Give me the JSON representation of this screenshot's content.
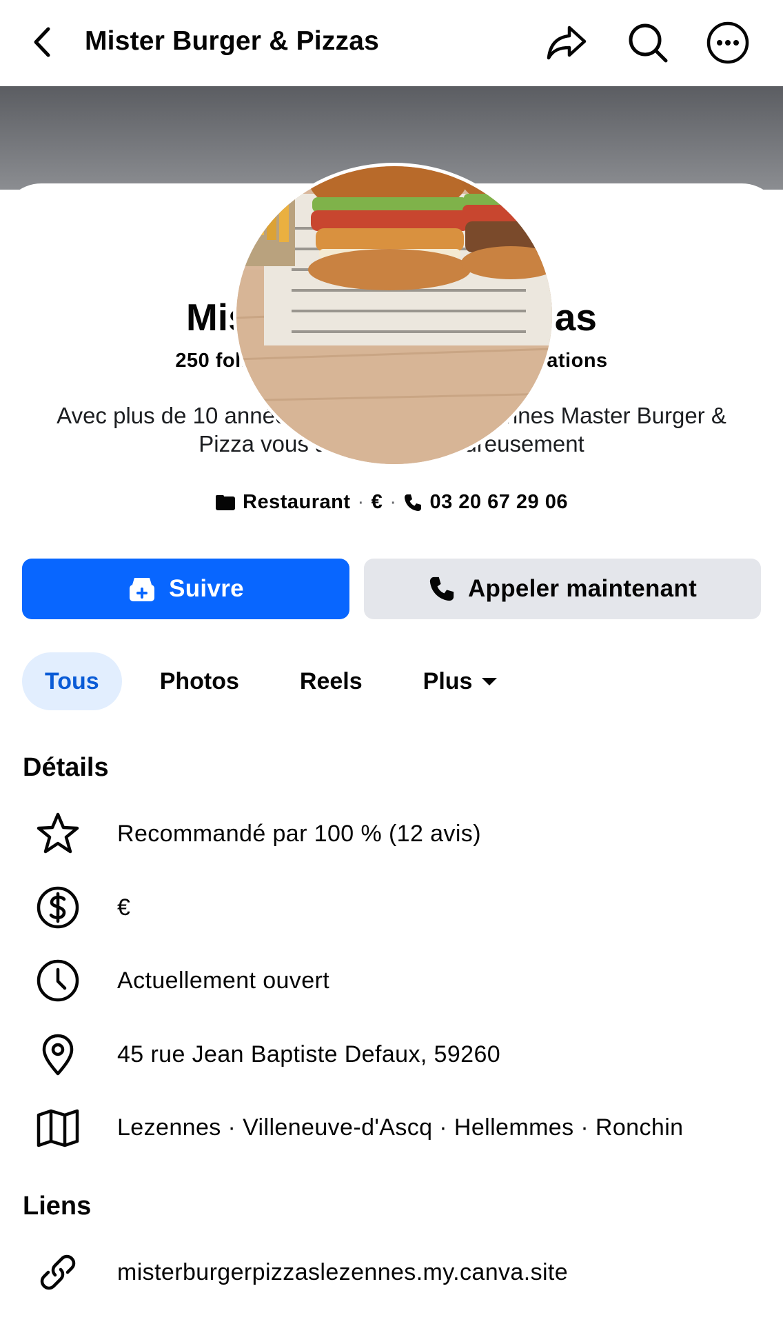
{
  "topbar": {
    "title": "Mister Burger & Pizzas",
    "icons": [
      "back-icon",
      "share-icon",
      "search-icon",
      "more-icon"
    ]
  },
  "profile": {
    "name": "Mister Burger & Pizzas",
    "stats": "250 followers · 14 suivi(e)s · 47 publications",
    "bio": "Avec plus de 10 années de présence à Lezennes Master Burger & Pizza vous accueille chaleureusement",
    "category": "Restaurant",
    "price": "€",
    "phone": "03 20 67 29 06",
    "separator": "·"
  },
  "actions": {
    "follow_label": "Suivre",
    "call_label": "Appeler maintenant"
  },
  "tabs": [
    {
      "label": "Tous",
      "active": true
    },
    {
      "label": "Photos",
      "active": false
    },
    {
      "label": "Reels",
      "active": false
    },
    {
      "label": "Plus",
      "active": false
    }
  ],
  "details": {
    "title": "Détails",
    "items": [
      {
        "icon": "star-icon",
        "text": "Recommandé par 100 % (12 avis)"
      },
      {
        "icon": "dollar-circle-icon",
        "text": "€"
      },
      {
        "icon": "clock-icon",
        "text": "Actuellement ouvert"
      },
      {
        "icon": "location-pin-icon",
        "text": "45 rue Jean Baptiste Defaux, 59260"
      },
      {
        "icon": "map-icon",
        "text": "Lezennes · Villeneuve-d'Ascq · Hellemmes · Ronchin"
      }
    ]
  },
  "links": {
    "title": "Liens",
    "items": [
      {
        "icon": "link-icon",
        "text": "misterburgerpizzaslezennes.my.canva.site"
      }
    ]
  },
  "colors": {
    "primary": "#0866ff",
    "secondary_button": "#e4e6eb",
    "active_tab_bg": "#e2eefe",
    "active_tab_text": "#0a5bd6"
  }
}
